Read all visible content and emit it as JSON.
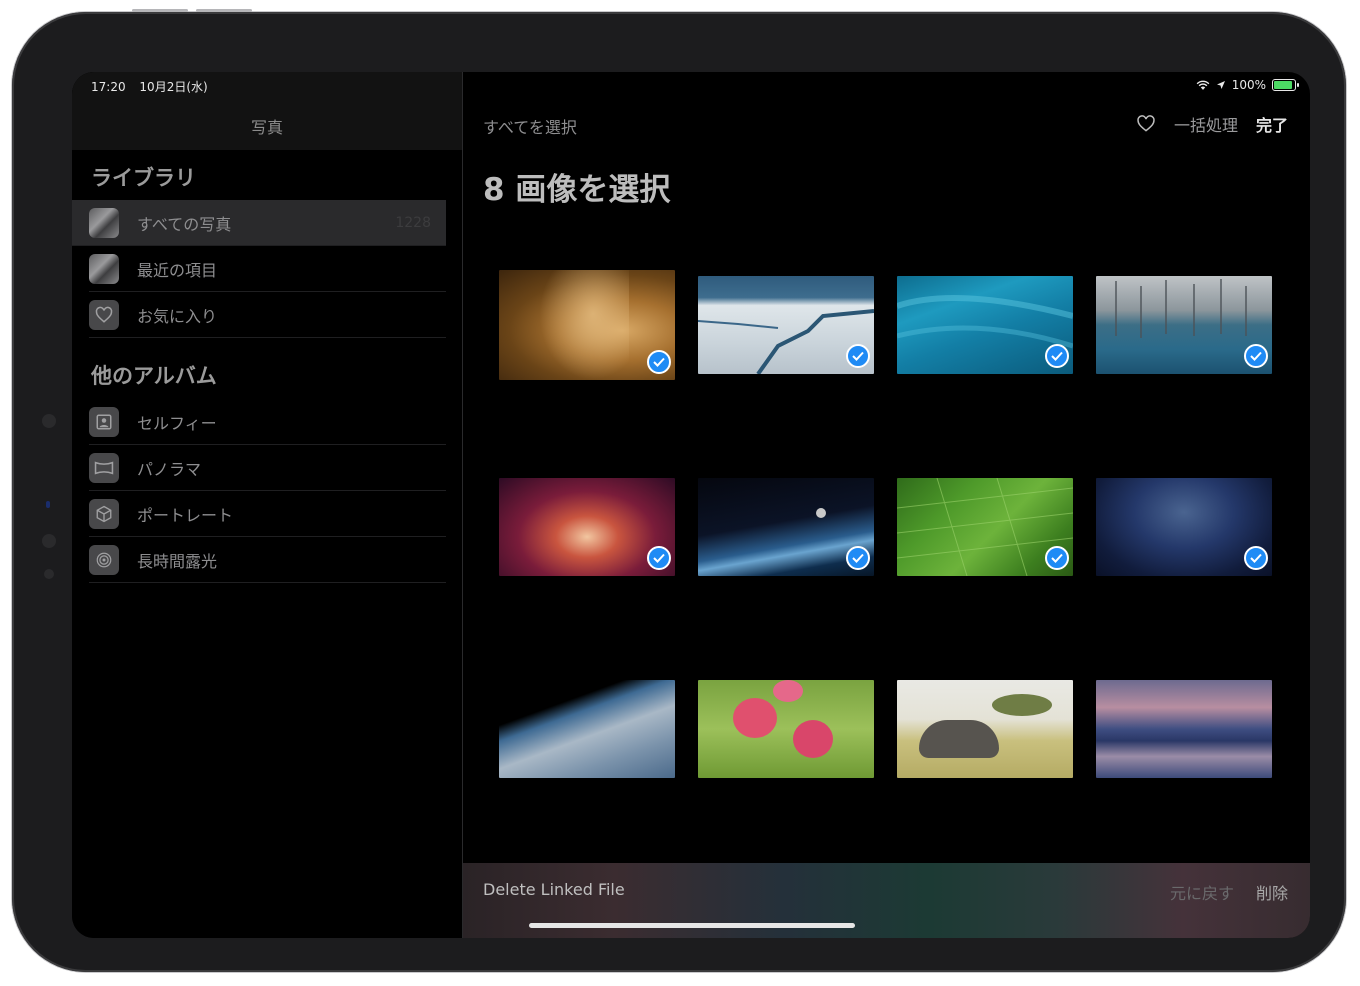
{
  "status_bar": {
    "time": "17:20",
    "date": "10月2日(水)",
    "battery": "100%"
  },
  "sidebar": {
    "title": "写真",
    "library_title": "ライブラリ",
    "library_items": [
      {
        "label": "すべての写真",
        "count": "1228",
        "icon": "photo-thumb"
      },
      {
        "label": "最近の項目",
        "icon": "photo-thumb"
      },
      {
        "label": "お気に入り",
        "icon": "heart-icon"
      }
    ],
    "albums_title": "他のアルバム",
    "album_items": [
      {
        "label": "セルフィー",
        "icon": "selfie-icon"
      },
      {
        "label": "パノラマ",
        "icon": "panorama-icon"
      },
      {
        "label": "ポートレート",
        "icon": "portrait-cube-icon"
      },
      {
        "label": "長時間露光",
        "icon": "long-exposure-icon"
      }
    ]
  },
  "main": {
    "select_all": "すべてを選択",
    "batch": "一括処理",
    "done": "完了",
    "title": "8 画像を選択",
    "photos": [
      {
        "subject": "lion",
        "selected": true
      },
      {
        "subject": "ice-floes",
        "selected": true
      },
      {
        "subject": "ocean-reef",
        "selected": true
      },
      {
        "subject": "frozen-forest-lake",
        "selected": true
      },
      {
        "subject": "red-canyon",
        "selected": true
      },
      {
        "subject": "earth-moon",
        "selected": true
      },
      {
        "subject": "green-fields",
        "selected": true
      },
      {
        "subject": "milky-way",
        "selected": true
      },
      {
        "subject": "earth-orbit",
        "selected": false
      },
      {
        "subject": "poppies",
        "selected": false
      },
      {
        "subject": "elephant",
        "selected": false
      },
      {
        "subject": "mountain-lake",
        "selected": false
      }
    ]
  },
  "bottom_bar": {
    "label": "Delete Linked File",
    "undo": "元に戻す",
    "delete": "削除"
  }
}
